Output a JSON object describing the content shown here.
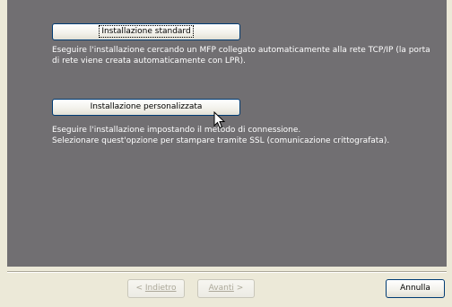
{
  "main": {
    "standard": {
      "button_label": "Installazione standard",
      "description_line1": "Eseguire l'installazione cercando un MFP collegato automaticamente alla rete TCP/IP (la porta",
      "description_line2": "di rete viene creata automaticamente con LPR)."
    },
    "custom": {
      "button_label": "Installazione personalizzata",
      "description_line1": "Eseguire l'installazione impostando il metodo di connessione.",
      "description_line2": "Selezionare quest'opzione per stampare tramite SSL (comunicazione crittografata)."
    }
  },
  "footer": {
    "back_arrow": "<",
    "back_label": "Indietro",
    "next_label": "Avanti",
    "next_arrow": ">",
    "cancel_label": "Annulla"
  },
  "colors": {
    "panel_background": "#716f72",
    "dialog_background": "#ece9d8",
    "description_text": "#ffffff"
  },
  "icons": {
    "pointer": "mouse-pointer-icon"
  }
}
